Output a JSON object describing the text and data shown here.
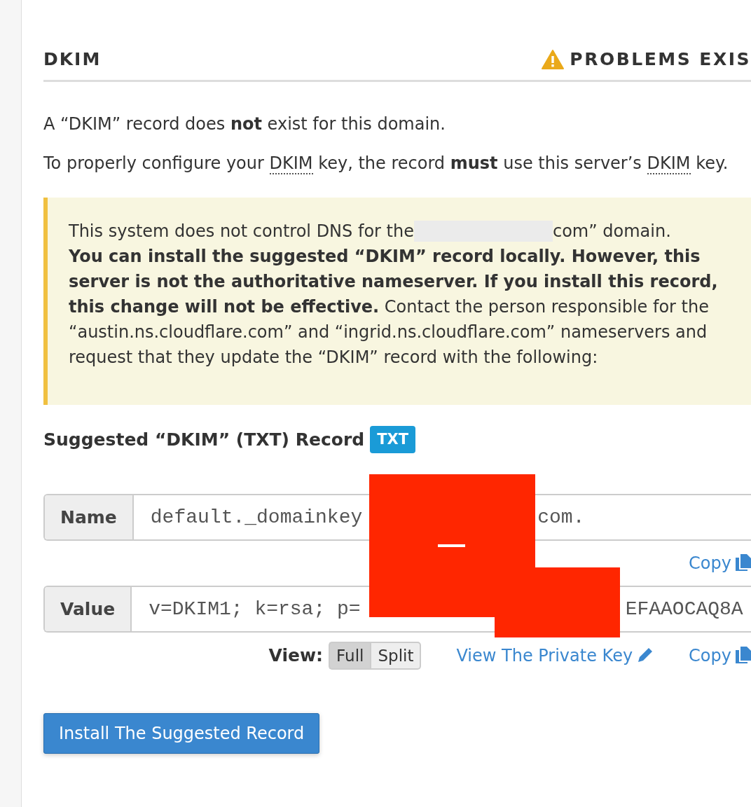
{
  "section": {
    "title": "DKIM",
    "status": {
      "kind": "warning",
      "text": "PROBLEMS EXIS"
    }
  },
  "paragraphs": [
    [
      {
        "kind": "text",
        "text": "A “DKIM” record does **not** exist for this domain."
      }
    ],
    [
      {
        "kind": "text",
        "text": "To properly configure your "
      },
      {
        "kind": "abbr",
        "text": "DKIM"
      },
      {
        "kind": "text",
        "text": " key, the record **must** use this server’s "
      },
      {
        "kind": "abbr",
        "text": "DKIM"
      },
      {
        "kind": "text",
        "text": " key."
      }
    ]
  ],
  "alert": {
    "kind": "warning",
    "before": "This system does not control DNS for the",
    "after": "com” domain.",
    "body": "**You can install the suggested “DKIM” record locally. However, this server is not the authoritative nameserver. If you install this record, this change will not be effective.** Contact the person responsible for the “austin.ns.cloudflare.com” and “ingrid.ns.cloudflare.com” nameservers and request that they update the “DKIM” record with the following:"
  },
  "record": {
    "title": "Suggested “DKIM” (TXT) Record",
    "badge": "TXT"
  },
  "fields": [
    {
      "label": "Name",
      "value_start": "default._domainkey",
      "value_end": "com.",
      "copy": "Copy"
    },
    {
      "label": "Value",
      "value_start": "v=DKIM1; k=rsa; p=",
      "value_end": "EFAAOCAQ8A",
      "copy": "Copy"
    }
  ],
  "view": {
    "label": "View:",
    "options": [
      {
        "label": "Full",
        "selected": true
      },
      {
        "label": "Split",
        "selected": false
      }
    ],
    "private_key_link": "View The Private Key"
  },
  "install_button": "Install The Suggested Record"
}
